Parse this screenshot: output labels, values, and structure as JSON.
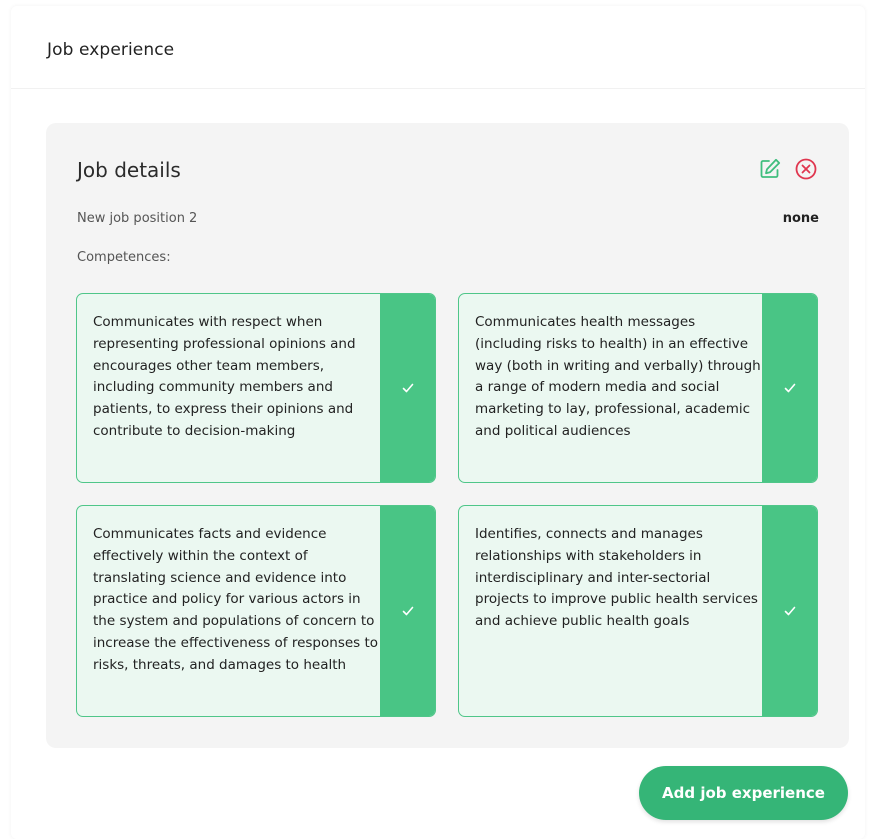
{
  "section": {
    "title": "Job experience"
  },
  "job_card": {
    "title": "Job details",
    "position_name": "New job position 2",
    "position_value": "none",
    "competences_label": "Competences:",
    "competences": [
      {
        "text": "Communicates with respect when representing professional opinions and encourages other team members, including community members and patients, to express their opinions and contribute to decision-making",
        "selected": true
      },
      {
        "text": "Communicates health messages (including risks to health) in an effective way (both in writing and verbally) through a range of modern media and social marketing to lay, professional, academic and political audiences",
        "selected": true
      },
      {
        "text": "Communicates facts and evidence effectively within the context of translating science and evidence into practice and policy for various actors in the system and populations of concern to increase the effectiveness of responses to risks, threats, and damages to health",
        "selected": true
      },
      {
        "text": "Identifies, connects and manages relationships with stakeholders in interdisciplinary and inter-sectorial projects to improve public health services and achieve public health goals",
        "selected": true
      }
    ]
  },
  "actions": {
    "add_label": "Add job experience"
  },
  "icons": {
    "edit": "edit-icon",
    "delete": "close-circle-icon",
    "check": "check-icon"
  },
  "colors": {
    "accent": "#35b577",
    "check_bg": "#49c585",
    "card_bg": "#ebf8f1",
    "delete": "#e0364f"
  }
}
